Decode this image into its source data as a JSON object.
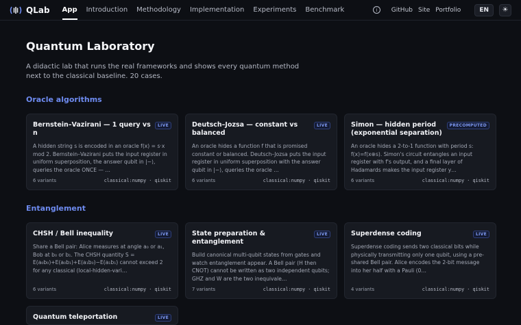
{
  "app": {
    "name": "QLab"
  },
  "nav": [
    "App",
    "Introduction",
    "Methodology",
    "Implementation",
    "Experiments",
    "Benchmark"
  ],
  "right_nav": {
    "links": [
      "GitHub",
      "Site",
      "Portfolio"
    ],
    "lang": "EN",
    "info_icon": "info-icon",
    "theme_icon": "sun-icon"
  },
  "page": {
    "title": "Quantum Laboratory",
    "description": "A didactic lab that runs the real frameworks and shows every quantum method next to the classical baseline. 20 cases."
  },
  "sections": [
    {
      "title": "Oracle algorithms",
      "cards": [
        {
          "title": "Bernstein–Vazirani — 1 query vs n",
          "badge": "LIVE",
          "description": "A hidden string s is encoded in an oracle f(x) = s·x mod 2. Bernstein–Vazirani puts the input register in uniform superposition, the answer qubit in |−⟩, queries the oracle ONCE — …",
          "variants": "6 variants",
          "stack": "classical:numpy · qiskit"
        },
        {
          "title": "Deutsch–Jozsa — constant vs balanced",
          "badge": "LIVE",
          "description": "An oracle hides a function f that is promised constant or balanced. Deutsch–Jozsa puts the input register in uniform superposition with the answer qubit in |−⟩, queries the oracle …",
          "variants": "6 variants",
          "stack": "classical:numpy · qiskit"
        },
        {
          "title": "Simon — hidden period (exponential separation)",
          "badge": "PRECOMPUTED",
          "description": "An oracle hides a 2-to-1 function with period s: f(x)=f(x⊕s). Simon's circuit entangles an input register with f's output, and a final layer of Hadamards makes the input register y…",
          "variants": "6 variants",
          "stack": "classical:numpy · qiskit"
        }
      ]
    },
    {
      "title": "Entanglement",
      "cards": [
        {
          "title": "CHSH / Bell inequality",
          "badge": "LIVE",
          "description": "Share a Bell pair: Alice measures at angle a₀ or a₁, Bob at b₀ or b₁. The CHSH quantity S = E(a₀b₀)+E(a₀b₁)+E(a₁b₀)−E(a₁b₁) cannot exceed 2 for any classical (local-hidden-vari…",
          "variants": "6 variants",
          "stack": "classical:numpy · qiskit"
        },
        {
          "title": "State preparation & entanglement",
          "badge": "LIVE",
          "description": "Build canonical multi-qubit states from gates and watch entanglement appear. A Bell pair (H then CNOT) cannot be written as two independent qubits; GHZ and W are the two inequivale…",
          "variants": "7 variants",
          "stack": "classical:numpy · qiskit"
        },
        {
          "title": "Superdense coding",
          "badge": "LIVE",
          "description": "Superdense coding sends two classical bits while physically transmitting only one qubit, using a pre-shared Bell pair. Alice encodes the 2-bit message into her half with a Pauli (0…",
          "variants": "4 variants",
          "stack": "classical:numpy · qiskit"
        },
        {
          "title": "Quantum teleportation",
          "badge": "LIVE",
          "description": "",
          "variants": "",
          "stack": ""
        }
      ]
    }
  ],
  "colors": {
    "accent": "#6e8bf0",
    "background": "#0d0f14",
    "card": "#171a21"
  }
}
